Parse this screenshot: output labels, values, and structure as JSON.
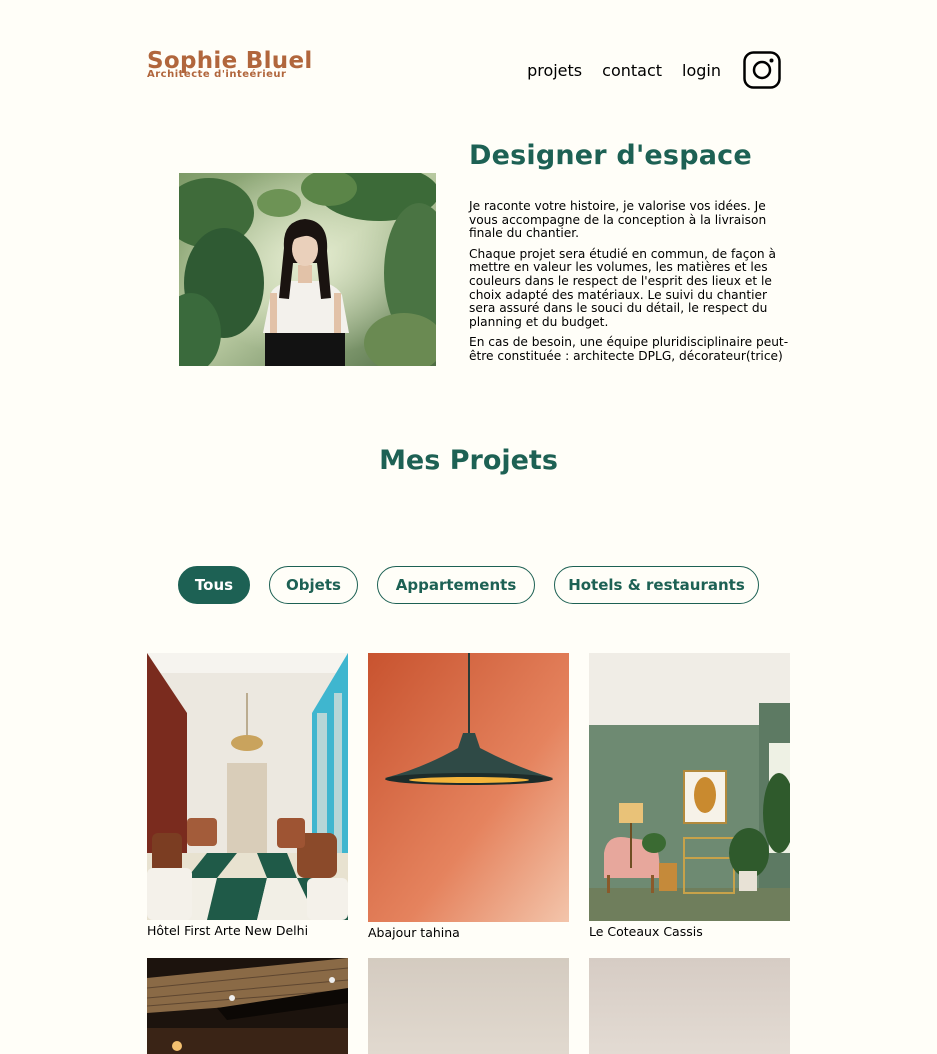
{
  "header": {
    "logo_title": "Sophie Bluel",
    "logo_subtitle": "Architecte d'inteérieur",
    "nav": [
      "projets",
      "contact",
      "login"
    ],
    "instagram_icon": "instagram-icon"
  },
  "introduction": {
    "title": "Designer d'espace",
    "paragraphs": [
      "Je raconte votre histoire, je valorise vos idées. Je vous accompagne de la conception à la livraison finale du chantier.",
      "Chaque projet sera étudié en commun, de façon à mettre en valeur les volumes, les matières et les couleurs dans le respect de l'esprit des lieux et le choix adapté des matériaux. Le suivi du chantier sera assuré dans le souci du détail, le respect du planning et du budget.",
      "En cas de besoin, une équipe pluridisciplinaire peut-être constituée : architecte DPLG, décorateur(trice)"
    ]
  },
  "portfolio": {
    "title": "Mes Projets",
    "filters": [
      "Tous",
      "Objets",
      "Appartements",
      "Hotels & restaurants"
    ],
    "active_filter": "Tous",
    "works": [
      {
        "caption": "Hôtel First Arte New Delhi"
      },
      {
        "caption": "Abajour tahina"
      },
      {
        "caption": "Le Coteaux Cassis"
      },
      {
        "caption": ""
      },
      {
        "caption": ""
      },
      {
        "caption": ""
      }
    ]
  },
  "colors": {
    "background": "#FFFEF8",
    "brand": "#B1663C",
    "accent": "#1D6154"
  }
}
